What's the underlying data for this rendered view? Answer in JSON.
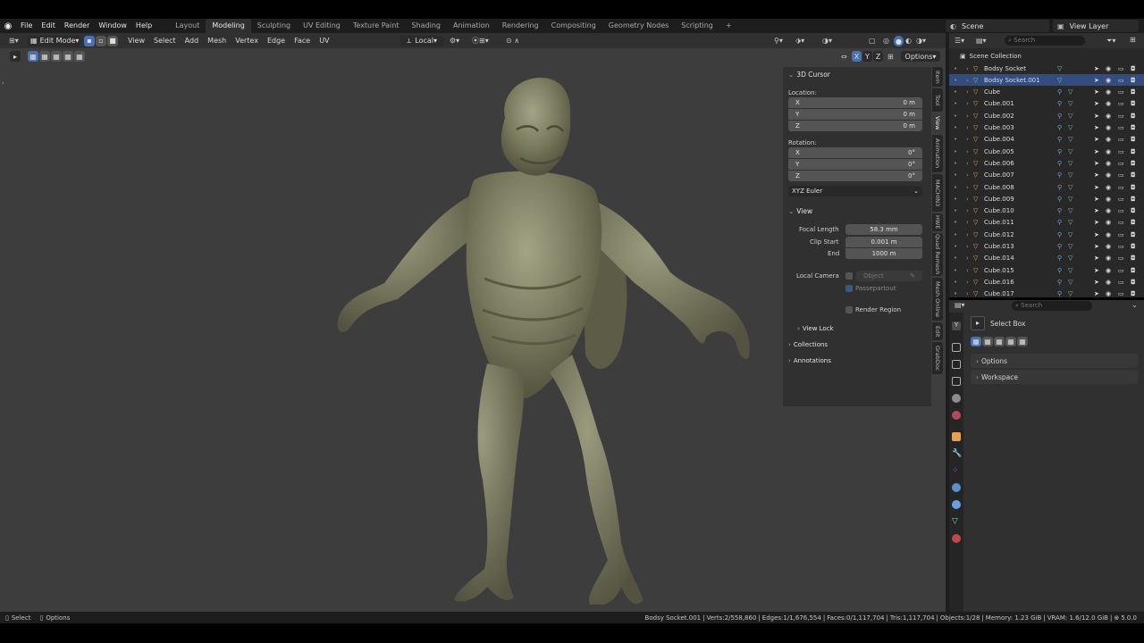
{
  "menu": [
    "File",
    "Edit",
    "Render",
    "Window",
    "Help"
  ],
  "workspaces": [
    "Layout",
    "Modeling",
    "Sculpting",
    "UV Editing",
    "Texture Paint",
    "Shading",
    "Animation",
    "Rendering",
    "Compositing",
    "Geometry Nodes",
    "Scripting",
    "+"
  ],
  "active_workspace": "Modeling",
  "scene": {
    "label": "Scene",
    "view_layer": "View Layer"
  },
  "viewport": {
    "mode": "Edit Mode",
    "menu": [
      "View",
      "Select",
      "Add",
      "Mesh",
      "Vertex",
      "Edge",
      "Face",
      "UV"
    ],
    "pivot": "Local",
    "axes": [
      "X",
      "Y",
      "Z"
    ],
    "options": "Options"
  },
  "npanel": {
    "cursor_title": "3D Cursor",
    "location_label": "Location:",
    "location": [
      {
        "axis": "X",
        "value": "0 m"
      },
      {
        "axis": "Y",
        "value": "0 m"
      },
      {
        "axis": "Z",
        "value": "0 m"
      }
    ],
    "rotation_label": "Rotation:",
    "rotation": [
      {
        "axis": "X",
        "value": "0°"
      },
      {
        "axis": "Y",
        "value": "0°"
      },
      {
        "axis": "Z",
        "value": "0°"
      }
    ],
    "rotation_mode": "XYZ Euler",
    "view_title": "View",
    "focal_label": "Focal Length",
    "focal": "58.3 mm",
    "clip_start_label": "Clip Start",
    "clip_start": "0.001 m",
    "end_label": "End",
    "end": "1000 m",
    "local_camera": "Local Camera",
    "object_placeholder": "Object",
    "passepartout": "Passepartout",
    "render_region": "Render Region",
    "view_lock": "View Lock",
    "collections": "Collections",
    "annotations": "Annotations",
    "tabs": [
      "Item",
      "Tool",
      "View",
      "Animation",
      "MACHIN3",
      "HWE",
      "Quad Remesh",
      "Mesh Online",
      "Edit",
      "GrabDoc"
    ],
    "active_tab": "View"
  },
  "outliner": {
    "search_placeholder": "Search",
    "collection": "Scene Collection",
    "items": [
      "Bodsy Socket",
      "Bodsy Socket.001",
      "Cube",
      "Cube.001",
      "Cube.002",
      "Cube.003",
      "Cube.004",
      "Cube.005",
      "Cube.006",
      "Cube.007",
      "Cube.008",
      "Cube.009",
      "Cube.010",
      "Cube.011",
      "Cube.012",
      "Cube.013",
      "Cube.014",
      "Cube.015",
      "Cube.016",
      "Cube.017"
    ]
  },
  "properties": {
    "search_placeholder": "Search",
    "tool_name": "Select Box",
    "options": "Options",
    "workspace": "Workspace"
  },
  "status": {
    "left": [
      "Select",
      "Options"
    ],
    "object": "Bodsy Socket.001",
    "verts": "Verts:2/558,860",
    "edges": "Edges:1/1,676,554",
    "faces": "Faces:0/1,117,704",
    "tris": "Tris:1,117,704",
    "objects": "Objects:1/28",
    "memory": "Memory: 1.23 GiB",
    "vram": "VRAM: 1.6/12.0 GiB",
    "version": "5.0.0"
  },
  "colors": {
    "accent": "#4772b3",
    "viewport": "#3d3d3d",
    "model": "#7a7a5e",
    "mesh_icon": "#6fd6a8",
    "object_icon": "#e8a04c"
  }
}
